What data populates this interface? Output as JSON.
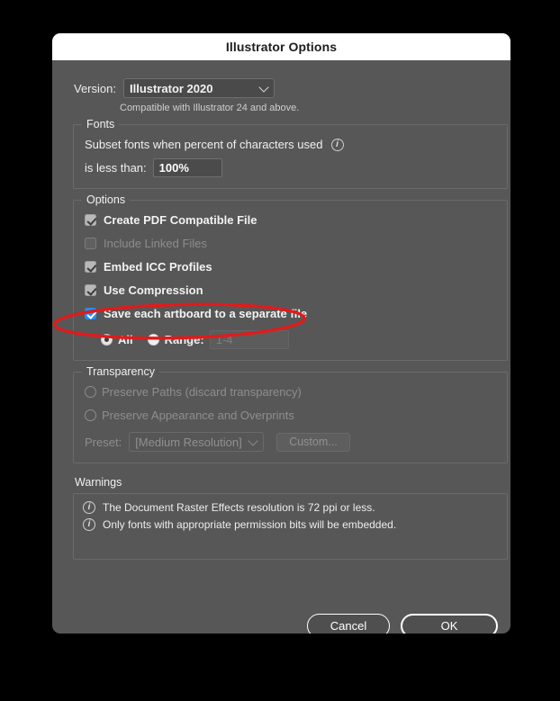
{
  "dialog": {
    "title": "Illustrator Options"
  },
  "version": {
    "label": "Version:",
    "selected": "Illustrator 2020",
    "compat_note": "Compatible with Illustrator 24 and above.",
    "chevron_icon": "chevron-down-icon"
  },
  "fonts": {
    "legend": "Fonts",
    "subset_text": "Subset fonts when percent of characters used",
    "info_icon": "info-icon",
    "less_than_label": "is less than:",
    "percent_value": "100%"
  },
  "options": {
    "legend": "Options",
    "items": [
      {
        "label": "Create PDF Compatible File",
        "checked": true,
        "enabled": true,
        "accent": "gray"
      },
      {
        "label": "Include Linked Files",
        "checked": false,
        "enabled": false,
        "accent": "gray"
      },
      {
        "label": "Embed ICC Profiles",
        "checked": true,
        "enabled": true,
        "accent": "gray"
      },
      {
        "label": "Use Compression",
        "checked": true,
        "enabled": true,
        "accent": "gray"
      },
      {
        "label": "Save each artboard to a separate file",
        "checked": true,
        "enabled": true,
        "accent": "blue"
      }
    ],
    "artboard_scope": {
      "all_label": "All",
      "all_selected": true,
      "range_label": "Range:",
      "range_selected": false,
      "range_value": "1-4",
      "range_enabled": false
    }
  },
  "transparency": {
    "legend": "Transparency",
    "options": [
      {
        "label": "Preserve Paths (discard transparency)",
        "selected": false,
        "enabled": false
      },
      {
        "label": "Preserve Appearance and Overprints",
        "selected": false,
        "enabled": false
      }
    ],
    "preset_label": "Preset:",
    "preset_value": "[Medium Resolution]",
    "custom_button": "Custom...",
    "enabled": false
  },
  "warnings": {
    "label": "Warnings",
    "items": [
      "The Document Raster Effects resolution is 72 ppi or less.",
      "Only fonts with appropriate permission bits will be embedded."
    ]
  },
  "footer": {
    "cancel": "Cancel",
    "ok": "OK"
  },
  "annotation": {
    "shape": "ellipse",
    "color": "#e01b1b",
    "target": "Save each artboard to a separate file"
  },
  "colors": {
    "dialog_bg": "#575757",
    "titlebar_bg": "#ffffff",
    "accent_blue": "#2a8bf2",
    "annotation_red": "#e01b1b",
    "backdrop": "#000000"
  }
}
